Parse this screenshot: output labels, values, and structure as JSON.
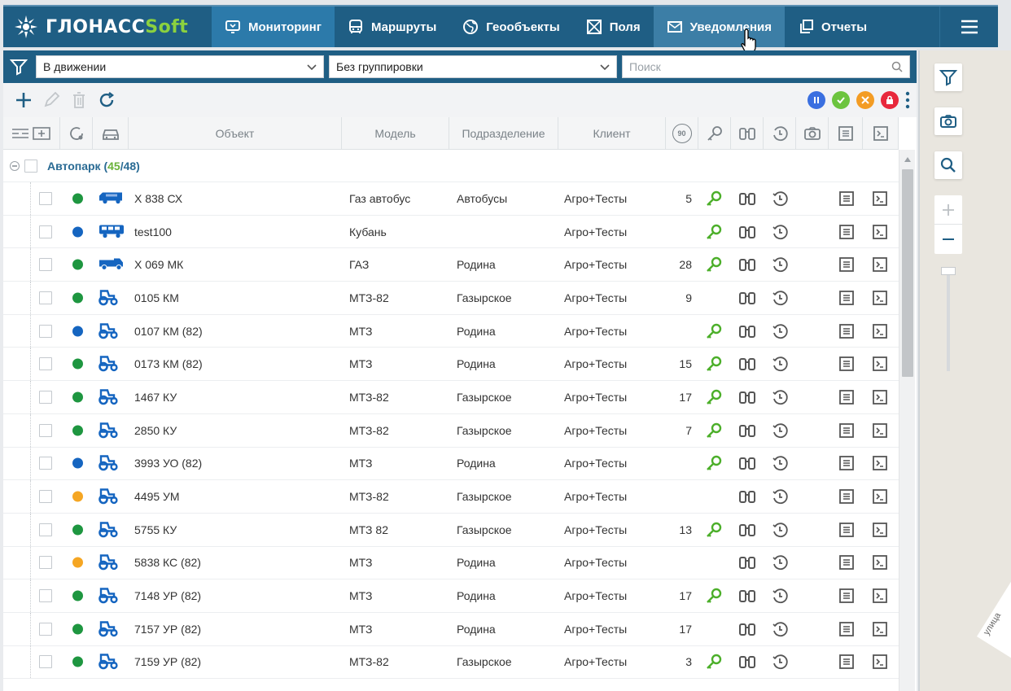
{
  "app": {
    "logo_main": "ГЛОНАСС",
    "logo_soft": "Soft",
    "nav": [
      {
        "label": "Мониторинг",
        "icon": "monitor-icon"
      },
      {
        "label": "Маршруты",
        "icon": "bus-icon"
      },
      {
        "label": "Геообъекты",
        "icon": "globe-icon"
      },
      {
        "label": "Поля",
        "icon": "field-icon"
      },
      {
        "label": "Уведомления",
        "icon": "mail-icon"
      },
      {
        "label": "Отчеты",
        "icon": "reports-icon"
      }
    ],
    "colors": {
      "header": "#1f5e84",
      "active_tab": "#2c7aaa",
      "green": "#1e9640",
      "blue": "#1565c0",
      "orange": "#f5a623",
      "key_green": "#4caf2a"
    }
  },
  "filters": {
    "status_value": "В движении",
    "grouping_value": "Без группировки",
    "search_placeholder": "Поиск"
  },
  "table": {
    "headers": {
      "object": "Объект",
      "model": "Модель",
      "division": "Подразделение",
      "client": "Клиент",
      "speed_icon": "90"
    },
    "group": {
      "name": "Автопарк",
      "online": "45",
      "total": "48"
    },
    "rows": [
      {
        "status": "green",
        "vehicle": "bus",
        "name": "Х 838 СХ",
        "model": "Газ автобус",
        "division": "Автобусы",
        "client": "Агро+Тесты",
        "speed": "5",
        "key": true
      },
      {
        "status": "blue",
        "vehicle": "bus2",
        "name": "test100",
        "model": "Кубань",
        "division": "",
        "client": "Агро+Тесты",
        "speed": "",
        "key": true
      },
      {
        "status": "green",
        "vehicle": "truck",
        "name": "Х 069 МК",
        "model": "ГАЗ",
        "division": "Родина",
        "client": "Агро+Тесты",
        "speed": "28",
        "key": true
      },
      {
        "status": "green",
        "vehicle": "tractor",
        "name": "0105 КМ",
        "model": "МТЗ-82",
        "division": "Газырское",
        "client": "Агро+Тесты",
        "speed": "9",
        "key": false
      },
      {
        "status": "blue",
        "vehicle": "tractor",
        "name": "0107 КМ (82)",
        "model": "МТЗ",
        "division": "Родина",
        "client": "Агро+Тесты",
        "speed": "",
        "key": true
      },
      {
        "status": "green",
        "vehicle": "tractor",
        "name": "0173 КМ (82)",
        "model": "МТЗ",
        "division": "Родина",
        "client": "Агро+Тесты",
        "speed": "15",
        "key": true
      },
      {
        "status": "green",
        "vehicle": "tractor",
        "name": "1467 КУ",
        "model": "МТЗ-82",
        "division": "Газырское",
        "client": "Агро+Тесты",
        "speed": "17",
        "key": true
      },
      {
        "status": "green",
        "vehicle": "tractor",
        "name": "2850 КУ",
        "model": "МТЗ-82",
        "division": "Газырское",
        "client": "Агро+Тесты",
        "speed": "7",
        "key": true
      },
      {
        "status": "blue",
        "vehicle": "tractor",
        "name": "3993 УО (82)",
        "model": "МТЗ",
        "division": "Родина",
        "client": "Агро+Тесты",
        "speed": "",
        "key": true
      },
      {
        "status": "orange",
        "vehicle": "tractor",
        "name": "4495 УМ",
        "model": "МТЗ-82",
        "division": "Газырское",
        "client": "Агро+Тесты",
        "speed": "",
        "key": false
      },
      {
        "status": "green",
        "vehicle": "tractor",
        "name": "5755 КУ",
        "model": "МТЗ 82",
        "division": "Газырское",
        "client": "Агро+Тесты",
        "speed": "13",
        "key": true
      },
      {
        "status": "orange",
        "vehicle": "tractor",
        "name": "5838 КС (82)",
        "model": "МТЗ",
        "division": "Родина",
        "client": "Агро+Тесты",
        "speed": "",
        "key": false
      },
      {
        "status": "green",
        "vehicle": "tractor",
        "name": "7148 УР (82)",
        "model": "МТЗ",
        "division": "Родина",
        "client": "Агро+Тесты",
        "speed": "17",
        "key": true
      },
      {
        "status": "green",
        "vehicle": "tractor",
        "name": "7157 УР (82)",
        "model": "МТЗ",
        "division": "Родина",
        "client": "Агро+Тесты",
        "speed": "17",
        "key": false
      },
      {
        "status": "green",
        "vehicle": "tractor",
        "name": "7159 УР (82)",
        "model": "МТЗ-82",
        "division": "Газырское",
        "client": "Агро+Тесты",
        "speed": "3",
        "key": true
      }
    ]
  },
  "map": {
    "street_label": "улица"
  }
}
